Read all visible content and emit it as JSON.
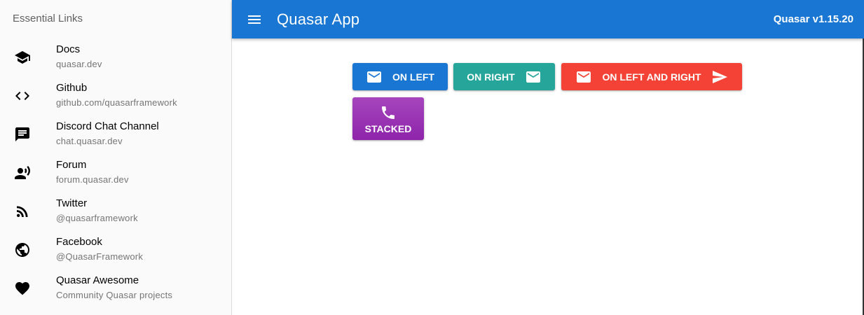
{
  "drawer": {
    "header": "Essential Links",
    "items": [
      {
        "title": "Docs",
        "caption": "quasar.dev",
        "icon": "school-icon"
      },
      {
        "title": "Github",
        "caption": "github.com/quasarframework",
        "icon": "code-icon"
      },
      {
        "title": "Discord Chat Channel",
        "caption": "chat.quasar.dev",
        "icon": "chat-icon"
      },
      {
        "title": "Forum",
        "caption": "forum.quasar.dev",
        "icon": "record-voice-icon"
      },
      {
        "title": "Twitter",
        "caption": "@quasarframework",
        "icon": "rss-feed-icon"
      },
      {
        "title": "Facebook",
        "caption": "@QuasarFramework",
        "icon": "public-icon"
      },
      {
        "title": "Quasar Awesome",
        "caption": "Community Quasar projects",
        "icon": "favorite-icon"
      }
    ]
  },
  "header": {
    "title": "Quasar App",
    "version": "Quasar v1.15.20"
  },
  "buttons": {
    "on_left": "On Left",
    "on_right": "On Right",
    "on_left_and_right": "On Left and Right",
    "stacked": "Stacked"
  },
  "colors": {
    "primary": "#1976d2",
    "teal": "#26a69a",
    "red": "#f44336",
    "purple": "#8e24aa"
  }
}
